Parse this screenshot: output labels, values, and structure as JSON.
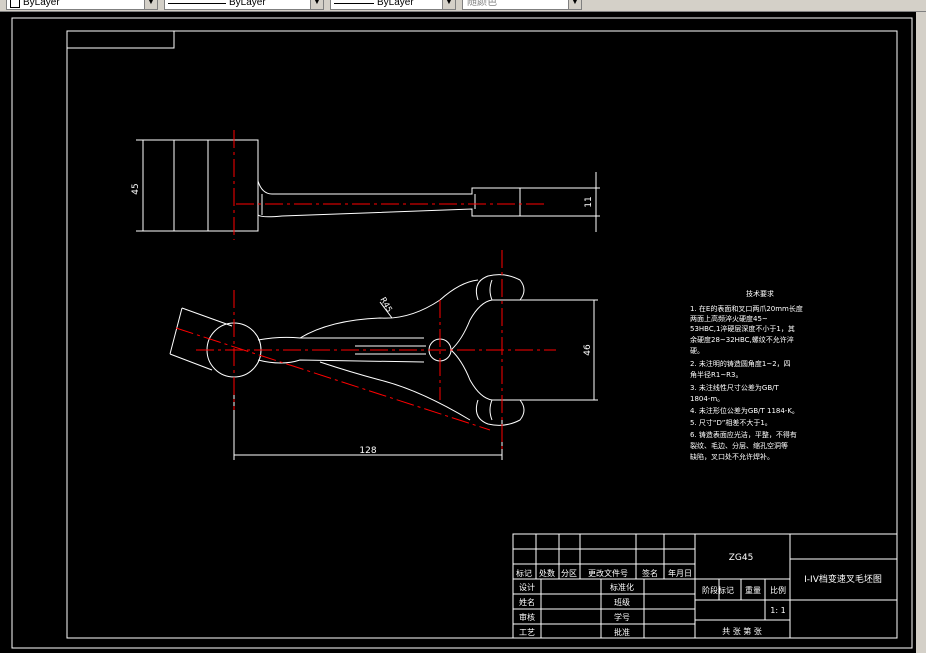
{
  "toolbar": {
    "layer_combo": "ByLayer",
    "linetype_combo": "ByLayer",
    "lineweight_combo": "ByLayer",
    "color_combo": "随颜色"
  },
  "dimensions": {
    "top_height": "45",
    "shaft_dia": "11",
    "fork_opening": "46",
    "radius": "R45",
    "length": "128"
  },
  "tech_requirements": {
    "title": "技术要求",
    "lines": [
      "1.   在E的表面和叉口两爪20mm长度",
      "       两面上高频淬火硬度45~",
      "       53HBC,1淬硬层深度不小于1，其",
      "       余硬度28~32HBC,螺纹不允许淬",
      "       硬。",
      "2.   未注明的铸造圆角度1~2，四",
      "       角半径R1~R3。",
      "3.   未注线性尺寸公差为GB/T",
      "       1804-m。",
      "4.   未注形位公差为GB/T 1184-K。",
      "5.   尺寸“D”相差不大于1。",
      "6.   铸造表面应光洁，平整，不得有",
      "       裂纹、毛边、分层、缩孔空洞等",
      "       缺陷，叉口处不允许焊补。"
    ]
  },
  "title_block": {
    "material": "ZG45",
    "part_name": "I-IV档变速叉毛坯图",
    "rev_headers": [
      "标记",
      "处数",
      "分区",
      "更改文件号",
      "签名",
      "年月日"
    ],
    "design": "设计",
    "standardize": "标准化",
    "name_label": "姓名",
    "class_label": "班级",
    "review": "审核",
    "student_no": "学号",
    "process": "工艺",
    "approve": "批准",
    "stage_mark": "阶段标记",
    "weight": "重量",
    "scale_label": "比例",
    "scale_value": "1: 1",
    "sheets": "共  张 第  张"
  }
}
